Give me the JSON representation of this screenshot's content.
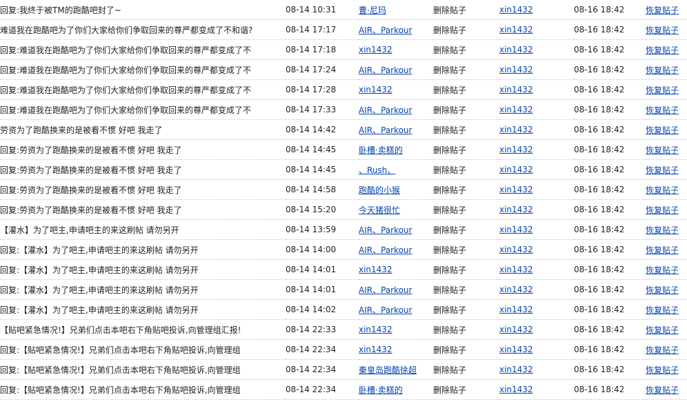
{
  "rows": [
    {
      "title": "回复:我终于被TM的跑酷吧封了~",
      "time": "08-14 10:31",
      "user": "曹·尼玛",
      "action": "删除贴子",
      "operator": "xin1432",
      "op_time": "08-16 18:42",
      "restore": "恢复贴子"
    },
    {
      "title": "难道我在跑酷吧为了你们大家给你们争取回来的尊严都变成了不和谐?",
      "time": "08-14 17:17",
      "user": "AIR、Parkour",
      "action": "删除贴子",
      "operator": "xin1432",
      "op_time": "08-16 18:42",
      "restore": "恢复贴子"
    },
    {
      "title": "回复:难道我在跑酷吧为了你们大家给你们争取回来的尊严都变成了不",
      "time": "08-14 17:18",
      "user": "xin1432",
      "action": "删除贴子",
      "operator": "xin1432",
      "op_time": "08-16 18:42",
      "restore": "恢复贴子"
    },
    {
      "title": "回复:难道我在跑酷吧为了你们大家给你们争取回来的尊严都变成了不",
      "time": "08-14 17:24",
      "user": "AIR、Parkour",
      "action": "删除贴子",
      "operator": "xin1432",
      "op_time": "08-16 18:42",
      "restore": "恢复贴子"
    },
    {
      "title": "回复:难道我在跑酷吧为了你们大家给你们争取回来的尊严都变成了不",
      "time": "08-14 17:28",
      "user": "xin1432",
      "action": "删除贴子",
      "operator": "xin1432",
      "op_time": "08-16 18:42",
      "restore": "恢复贴子"
    },
    {
      "title": "回复:难道我在跑酷吧为了你们大家给你们争取回来的尊严都变成了不",
      "time": "08-14 17:33",
      "user": "AIR、Parkour",
      "action": "删除贴子",
      "operator": "xin1432",
      "op_time": "08-16 18:42",
      "restore": "恢复贴子"
    },
    {
      "title": "劳资为了跑酷换来的是被看不惯 好吧 我走了",
      "time": "08-14 14:42",
      "user": "AIR、Parkour",
      "action": "删除贴子",
      "operator": "xin1432",
      "op_time": "08-16 18:42",
      "restore": "恢复贴子"
    },
    {
      "title": "回复:劳资为了跑酷换来的是被看不惯 好吧 我走了",
      "time": "08-14 14:45",
      "user": "卧槽·卖糕的",
      "action": "删除贴子",
      "operator": "xin1432",
      "op_time": "08-16 18:42",
      "restore": "恢复贴子"
    },
    {
      "title": "回复:劳资为了跑酷换来的是被看不惯 好吧 我走了",
      "time": "08-14 14:45",
      "user": "、Rush、",
      "action": "删除贴子",
      "operator": "xin1432",
      "op_time": "08-16 18:42",
      "restore": "恢复贴子"
    },
    {
      "title": "回复:劳资为了跑酷换来的是被看不惯 好吧 我走了",
      "time": "08-14 14:58",
      "user": "跑酷的小猴",
      "action": "删除贴子",
      "operator": "xin1432",
      "op_time": "08-16 18:42",
      "restore": "恢复贴子"
    },
    {
      "title": "回复:劳资为了跑酷换来的是被看不惯 好吧 我走了",
      "time": "08-14 15:20",
      "user": "今天猪很忙",
      "action": "删除贴子",
      "operator": "xin1432",
      "op_time": "08-16 18:42",
      "restore": "恢复贴子"
    },
    {
      "title": "【灌水】为了吧主,申请吧主的来这刷帖 请勿另开",
      "time": "08-14 13:59",
      "user": "AIR、Parkour",
      "action": "删除贴子",
      "operator": "xin1432",
      "op_time": "08-16 18:42",
      "restore": "恢复贴子"
    },
    {
      "title": "回复:【灌水】为了吧主,申请吧主的来这刷帖 请勿另开",
      "time": "08-14 14:00",
      "user": "AIR、Parkour",
      "action": "删除贴子",
      "operator": "xin1432",
      "op_time": "08-16 18:42",
      "restore": "恢复贴子"
    },
    {
      "title": "回复:【灌水】为了吧主,申请吧主的来这刷帖 请勿另开",
      "time": "08-14 14:01",
      "user": "xin1432",
      "action": "删除贴子",
      "operator": "xin1432",
      "op_time": "08-16 18:42",
      "restore": "恢复贴子"
    },
    {
      "title": "回复:【灌水】为了吧主,申请吧主的来这刷帖 请勿另开",
      "time": "08-14 14:01",
      "user": "AIR、Parkour",
      "action": "删除贴子",
      "operator": "xin1432",
      "op_time": "08-16 18:42",
      "restore": "恢复贴子"
    },
    {
      "title": "回复:【灌水】为了吧主,申请吧主的来这刷帖 请勿另开",
      "time": "08-14 14:02",
      "user": "AIR、Parkour",
      "action": "删除贴子",
      "operator": "xin1432",
      "op_time": "08-16 18:42",
      "restore": "恢复贴子"
    },
    {
      "title": "【贴吧紧急情况!】兄弟们点击本吧右下角贴吧投诉,向管理组汇报!",
      "time": "08-14 22:33",
      "user": "xin1432",
      "action": "删除贴子",
      "operator": "xin1432",
      "op_time": "08-16 18:42",
      "restore": "恢复贴子"
    },
    {
      "title": "回复:【贴吧紧急情况!】兄弟们点击本吧右下角贴吧投诉,向管理组",
      "time": "08-14 22:34",
      "user": "xin1432",
      "action": "删除贴子",
      "operator": "xin1432",
      "op_time": "08-16 18:42",
      "restore": "恢复贴子"
    },
    {
      "title": "回复:【贴吧紧急情况!】兄弟们点击本吧右下角贴吧投诉,向管理组",
      "time": "08-14 22:34",
      "user": "秦皇岛跑酷徐超",
      "action": "删除贴子",
      "operator": "xin1432",
      "op_time": "08-16 18:42",
      "restore": "恢复贴子"
    },
    {
      "title": "回复:【贴吧紧急情况!】兄弟们点击本吧右下角贴吧投诉,向管理组",
      "time": "08-14 22:34",
      "user": "卧槽·卖糕的",
      "action": "删除贴子",
      "operator": "xin1432",
      "op_time": "08-16 18:42",
      "restore": "恢复贴子"
    }
  ]
}
